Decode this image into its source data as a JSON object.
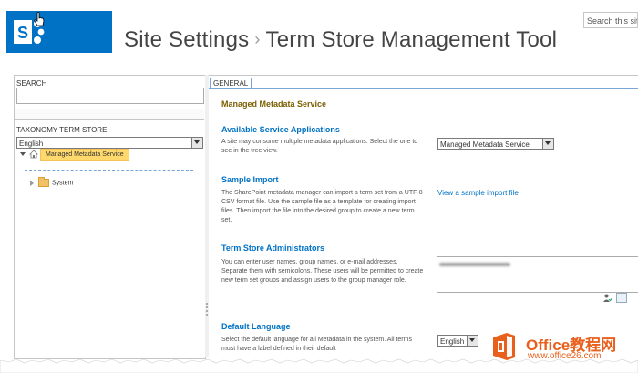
{
  "header": {
    "title_part1": "Site Settings",
    "separator": "›",
    "title_part2": "Term Store Management Tool",
    "search_placeholder": "Search this site",
    "logo_icon": "sharepoint-logo-icon",
    "brand_color": "#0072c6"
  },
  "left": {
    "search_label": "SEARCH",
    "search_value": "",
    "taxonomy_label": "TAXONOMY TERM STORE",
    "language_value": "English",
    "tree": {
      "root_label": "Managed Metadata Service",
      "child_label": "System"
    }
  },
  "right": {
    "tab_label": "GENERAL",
    "service_title": "Managed Metadata Service",
    "sections": [
      {
        "title": "Available Service Applications",
        "text": "A site may consume multiple metadata applications. Select the one to see in the tree view."
      },
      {
        "title": "Sample Import",
        "text": "The SharePoint metadata manager can import a term set from a UTF-8 CSV format file. Use the sample file as a template for creating import files. Then import the file into the desired group to create a new term set."
      },
      {
        "title": "Term Store Administrators",
        "text": "You can enter user names, group names, or e-mail addresses. Separate them with semicolons. These users will be permitted to create new term set groups and assign users to the group manager role."
      },
      {
        "title": "Default Language",
        "text": "Select the default language for all Metadata in the system. All terms must have a label defined in their default"
      }
    ],
    "service_select_value": "Managed Metadata Service",
    "sample_link": "View a sample import file",
    "default_language_value": "English"
  },
  "watermark": {
    "title": "Office教程网",
    "url": "www.office26.com",
    "color": "#e8601c"
  }
}
